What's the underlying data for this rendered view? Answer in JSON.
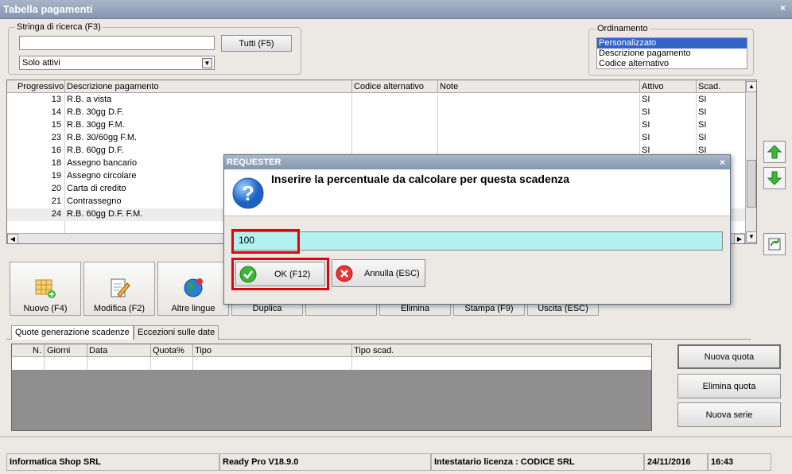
{
  "window": {
    "title": "Tabella pagamenti",
    "close": "×"
  },
  "search": {
    "label": "Stringa di ricerca (F3)",
    "value": "",
    "all_button": "Tutti (F5)",
    "filter_value": "Solo attivi"
  },
  "sort": {
    "label": "Ordinamento",
    "options": [
      "Personalizzato",
      "Descrizione pagamento",
      "Codice alternativo"
    ],
    "selected": "Personalizzato"
  },
  "table": {
    "columns": [
      "Progressivo",
      "Descrizione pagamento",
      "Codice alternativo",
      "Note",
      "Attivo",
      "Scad."
    ],
    "rows": [
      {
        "prog": "13",
        "desc": "R.B. a vista",
        "attivo": "SI",
        "scad": "SI"
      },
      {
        "prog": "14",
        "desc": "R.B. 30gg D.F.",
        "attivo": "SI",
        "scad": "SI"
      },
      {
        "prog": "15",
        "desc": "R.B. 30gg F.M.",
        "attivo": "SI",
        "scad": "SI"
      },
      {
        "prog": "23",
        "desc": "R.B. 30/60gg F.M.",
        "attivo": "SI",
        "scad": "SI"
      },
      {
        "prog": "16",
        "desc": "R.B. 60gg D.F.",
        "attivo": "SI",
        "scad": "SI"
      },
      {
        "prog": "18",
        "desc": "Assegno bancario",
        "attivo": "",
        "scad": ""
      },
      {
        "prog": "19",
        "desc": "Assegno circolare",
        "attivo": "",
        "scad": ""
      },
      {
        "prog": "20",
        "desc": "Carta di credito",
        "attivo": "",
        "scad": ""
      },
      {
        "prog": "21",
        "desc": "Contrassegno",
        "attivo": "",
        "scad": ""
      },
      {
        "prog": "24",
        "desc": "R.B. 60gg D.F. F.M.",
        "attivo": "",
        "scad": ""
      }
    ]
  },
  "toolbar": {
    "nuovo": "Nuovo (F4)",
    "modifica": "Modifica (F2)",
    "altre_lingue": "Altre lingue",
    "duplica": "Duplica",
    "elimina": "Elimina",
    "stampa": "Stampa (F9)",
    "uscita": "Uscita (ESC)"
  },
  "tabs": [
    "Quote generazione scadenze",
    "Eccezioni sulle date"
  ],
  "quote_table": {
    "columns": [
      "N.",
      "Giorni",
      "Data",
      "Quota%",
      "Tipo",
      "Tipo scad."
    ]
  },
  "side_buttons": {
    "nuova_quota": "Nuova quota",
    "elimina_quota": "Elimina quota",
    "nuova_serie": "Nuova serie"
  },
  "status": {
    "company": "Informatica Shop SRL",
    "version": "Ready Pro V18.9.0",
    "license": "Intestatario licenza : CODICE SRL",
    "date": "24/11/2016",
    "time": "16:43"
  },
  "dialog": {
    "title": "REQUESTER",
    "message": "Inserire la percentuale da calcolare per questa scadenza",
    "value": "100",
    "ok": "OK (F12)",
    "cancel": "Annulla (ESC)"
  },
  "colors": {
    "title": "#8496b0",
    "input_bg": "#b3f1f0",
    "selection": "#3264c8",
    "highlight": "#e00010"
  }
}
